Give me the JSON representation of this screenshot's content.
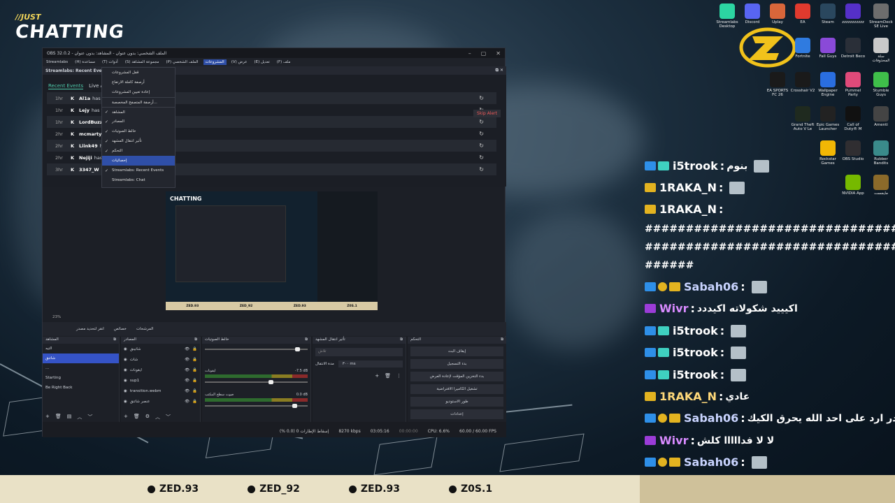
{
  "overlay": {
    "logo_top": "//JUST",
    "logo_main": "CHATTING",
    "socials": [
      {
        "icon": "snapchat-icon",
        "handle": "ZED.93"
      },
      {
        "icon": "x-icon",
        "handle": "ZED_92"
      },
      {
        "icon": "tiktok-icon",
        "handle": "ZED.93"
      },
      {
        "icon": "instagram-icon",
        "handle": "Z0S.1"
      }
    ],
    "accent": "#e9e1c6"
  },
  "obs": {
    "title": "OBS 32.0.2 - الملف الشخصي: بدون عنوان - المشاهد: بدون عنوان",
    "menu": [
      "ملف (F)",
      "تعديل (E)",
      "عرض (V)",
      "المشروعات",
      "الملف الشخصي (P)",
      "مجموعة المشاهد (S)",
      "أدوات (T)",
      "مساعدة (H)",
      "Streamlabs"
    ],
    "active_menu": "المشروعات",
    "dock_title": "Streamlabs: Recent Events",
    "tabs": [
      "Recent Events",
      "Live Ac"
    ],
    "skip_alert": "Skip Alert",
    "events": [
      {
        "time": "1hr",
        "name": "Al1a",
        "text": "has fol"
      },
      {
        "time": "1hr",
        "name": "Lejy",
        "text": "has fol"
      },
      {
        "time": "1hr",
        "name": "LordBuzz",
        "text": "ha"
      },
      {
        "time": "2hr",
        "name": "mcmarty",
        "text": "ha"
      },
      {
        "time": "2hr",
        "name": "Liink49",
        "text": "has"
      },
      {
        "time": "2hr",
        "name": "Nejiji",
        "text": "has fo"
      },
      {
        "time": "3hr",
        "name": "3347_W",
        "text": "has"
      }
    ],
    "menu_items": [
      {
        "label": "قفل المشروعات",
        "check": false,
        "sep": false,
        "sel": false
      },
      {
        "label": "أرصفة كاملة الارتفاع",
        "check": false,
        "sep": false,
        "sel": false
      },
      {
        "label": "إعادة تعيين المشروعات",
        "check": false,
        "sep": false,
        "sel": false
      },
      {
        "label": "أرصفة المتصفح المخصصة...",
        "check": false,
        "sep": true,
        "sel": false
      },
      {
        "label": "المشاهد",
        "check": true,
        "sep": true,
        "sel": false
      },
      {
        "label": "المصادر",
        "check": true,
        "sep": false,
        "sel": false
      },
      {
        "label": "خالط الصوتيات",
        "check": true,
        "sep": false,
        "sel": false
      },
      {
        "label": "تأثير انتقال المشهد",
        "check": true,
        "sep": false,
        "sel": false
      },
      {
        "label": "التحكم",
        "check": true,
        "sep": false,
        "sel": false
      },
      {
        "label": "إحصائيات",
        "check": false,
        "sep": false,
        "sel": true
      },
      {
        "label": "Streamlabs: Recent Events",
        "check": true,
        "sep": false,
        "sel": false
      },
      {
        "label": "Streamlabs: Chat",
        "check": false,
        "sep": false,
        "sel": false
      }
    ],
    "zoom": "23%",
    "controls": [
      "انقر لتحديد مصدر",
      "خصائص",
      "المرشحات"
    ],
    "docks": {
      "scenes_title": "المشاهد",
      "scenes": [
        "التيه",
        "شاتنق",
        "...",
        "Starting",
        "Be Right Back"
      ],
      "selected_scene": "شاتنق",
      "sources_title": "المصادر",
      "sources": [
        "شاتينق",
        "شات",
        "ايقونات",
        "sup1",
        "transition.webm",
        "عنصر شاتنق"
      ],
      "mixer_title": "خالط الصوتيات",
      "mixer": [
        {
          "name": "ايقونات",
          "db": "-7.5 dB"
        },
        {
          "name": "صوت سطح المكتب",
          "db": "0.0 dB"
        }
      ],
      "transition_title": "تأثير انتقال المشهد",
      "transition_value": "٣٠٠ ms",
      "transition_label": "مدة الانتقال",
      "transition_select": "تلاش",
      "controls_title": "التحكم",
      "control_buttons": [
        "إيقاف البث",
        "بدء التسجيل",
        "بدء التخزين المؤقت لإعادة العرض",
        "تشغيل الكاميرا الافتراضية",
        "طور الاستوديو",
        "إعدادات"
      ]
    },
    "status": {
      "dropped": "إسقاط الإطارات 0 (0.0 %)",
      "bitrate": "8270 kbps",
      "live_time": "03:05:16",
      "rec_time": "00:00:00",
      "cpu": "CPU: 6.6%",
      "fps": "60.00 / 60.00 FPS"
    },
    "preview": {
      "logo": "CHATTING",
      "bar": [
        "ZED.93",
        "ZED_92",
        "ZED.93",
        "Z0S.1"
      ]
    }
  },
  "desktop_icons": [
    {
      "label": "Streamlabs Desktop",
      "color": "#2cd5a2"
    },
    {
      "label": "Discord",
      "color": "#5865f2"
    },
    {
      "label": "Uplay",
      "color": "#d8663a"
    },
    {
      "label": "EA",
      "color": "#e03a2e"
    },
    {
      "label": "Steam",
      "color": "#2a475e"
    },
    {
      "label": "zzzzzzzzzzz",
      "color": "#5530c8"
    },
    {
      "label": "StreamDeck SE Live",
      "color": "#6d6d6d"
    },
    {
      "label": "Fortnite",
      "color": "#2f7be0"
    },
    {
      "label": "Fall Guys",
      "color": "#8a4ad8"
    },
    {
      "label": "Detroit Beco",
      "color": "#2a2f38"
    },
    {
      "label": "سلة المحذوفات",
      "color": "#c9c9c9"
    },
    {
      "label": "EA SPORTS FC 26",
      "color": "#1a1a1a"
    },
    {
      "label": "Crosshair V2",
      "color": "#1a1a1a"
    },
    {
      "label": "Wallpaper Engine",
      "color": "#2a6ee0"
    },
    {
      "label": "Pummel Party",
      "color": "#e04a7a"
    },
    {
      "label": "Stumble Guys",
      "color": "#3fbf4a"
    },
    {
      "label": "Grand Theft Auto V Le",
      "color": "#1f2a1f"
    },
    {
      "label": "Epic Games Launcher",
      "color": "#222"
    },
    {
      "label": "Call of Duty® M",
      "color": "#111"
    },
    {
      "label": "Amenti",
      "color": "#444"
    },
    {
      "label": "Rockstar Games",
      "color": "#f2b705"
    },
    {
      "label": "OBS Studio",
      "color": "#302e31"
    },
    {
      "label": "Rubber Bandits",
      "color": "#3a8a8a"
    },
    {
      "label": "NVIDIA App",
      "color": "#76b900"
    },
    {
      "label": "مايجست",
      "color": "#8b6a2a"
    }
  ],
  "chat": [
    {
      "badges": [
        "b-blue",
        "b-teal"
      ],
      "user": "i5trook",
      "color": "#ffffff",
      "text": "بنوم",
      "avatar": true
    },
    {
      "badges": [
        "b-gold"
      ],
      "user": "1RAKA_N",
      "color": "#ffffff",
      "text": "",
      "avatar": true
    },
    {
      "badges": [
        "b-gold"
      ],
      "user": "1RAKA_N",
      "color": "#ffffff",
      "text": "",
      "avatar": false
    },
    {
      "badges": [],
      "user": "",
      "color": "#ffffff",
      "text": "######################################",
      "avatar": false
    },
    {
      "badges": [],
      "user": "",
      "color": "#ffffff",
      "text": "######################################",
      "avatar": false
    },
    {
      "badges": [],
      "user": "",
      "color": "#ffffff",
      "text": "######",
      "avatar": false
    },
    {
      "badges": [
        "b-blue",
        "b-coin",
        "b-gold"
      ],
      "user": "Sabah06",
      "color": "#c9d4ff",
      "text": "",
      "avatar": true
    },
    {
      "badges": [
        "b-purple"
      ],
      "user": "Wivr",
      "color": "#d88bff",
      "text": "اكيييد شكولاته اكيددد",
      "avatar": false
    },
    {
      "badges": [
        "b-blue",
        "b-teal"
      ],
      "user": "i5trook",
      "color": "#ffffff",
      "text": "",
      "avatar": true
    },
    {
      "badges": [
        "b-blue",
        "b-teal"
      ],
      "user": "i5trook",
      "color": "#ffffff",
      "text": "",
      "avatar": true
    },
    {
      "badges": [
        "b-blue",
        "b-teal"
      ],
      "user": "i5trook",
      "color": "#ffffff",
      "text": "",
      "avatar": true
    },
    {
      "badges": [
        "b-gold"
      ],
      "user": "1RAKA_N",
      "color": "#ffd97a",
      "text": "عادي",
      "avatar": false
    },
    {
      "badges": [
        "b-blue",
        "b-coin",
        "b-gold"
      ],
      "user": "Sabah06",
      "color": "#c9d4ff",
      "text": "ماقدر ارد على احد الله يحرق الكيك",
      "avatar": false
    },
    {
      "badges": [
        "b-purple"
      ],
      "user": "Wivr",
      "color": "#d88bff",
      "text": "لا لا فدااااا كلش",
      "avatar": false
    },
    {
      "badges": [
        "b-blue",
        "b-coin",
        "b-gold"
      ],
      "user": "Sabah06",
      "color": "#c9d4ff",
      "text": "",
      "avatar": true
    }
  ]
}
